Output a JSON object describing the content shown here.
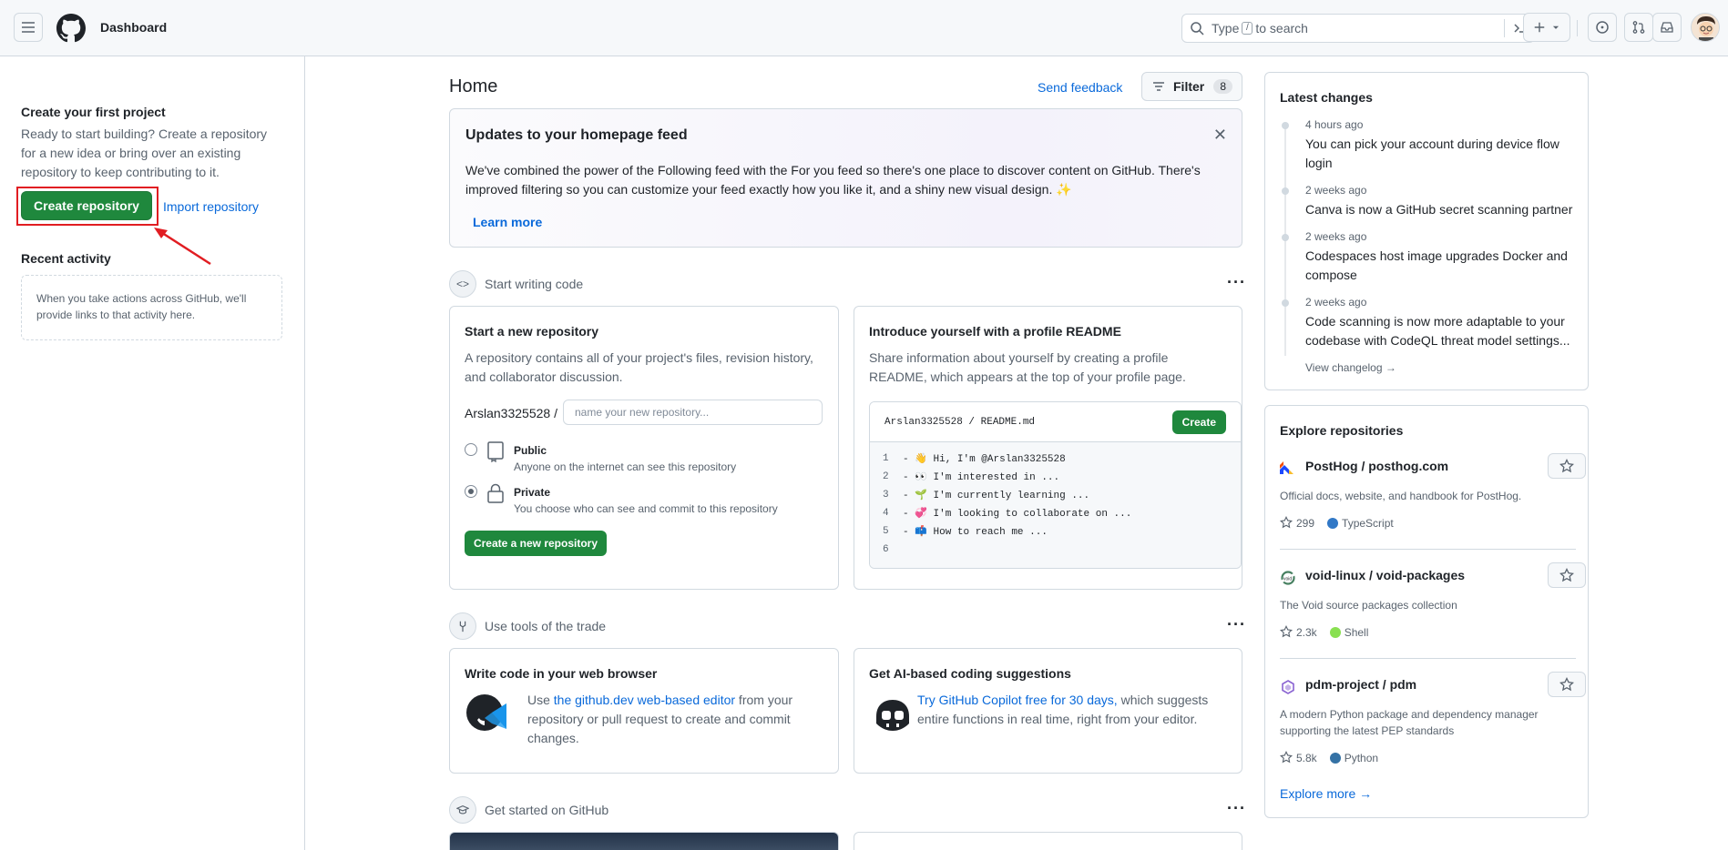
{
  "header": {
    "title": "Dashboard",
    "search": {
      "before_key": "Type",
      "key": "/",
      "after_key": "to search"
    }
  },
  "sidebar": {
    "create_title": "Create your first project",
    "create_desc": "Ready to start building? Create a repository for a new idea or bring over an existing repository to keep contributing to it.",
    "create_button": "Create repository",
    "import_link": "Import repository",
    "recent_title": "Recent activity",
    "recent_empty": "When you take actions across GitHub, we'll provide links to that activity here."
  },
  "main": {
    "title": "Home",
    "feedback": "Send feedback",
    "filter_label": "Filter",
    "filter_count": "8",
    "update": {
      "title": "Updates to your homepage feed",
      "text": "We've combined the power of the Following feed with the For you feed so there's one place to discover content on GitHub. There's improved filtering so you can customize your feed exactly how you like it, and a shiny new visual design. ✨",
      "learn_more": "Learn more"
    },
    "section1": "Start writing code",
    "new_repo": {
      "title": "Start a new repository",
      "desc": "A repository contains all of your project's files, revision history, and collaborator discussion.",
      "owner": "Arslan3325528 /",
      "placeholder": "name your new repository...",
      "public_label": "Public",
      "public_desc": "Anyone on the internet can see this repository",
      "private_label": "Private",
      "private_desc": "You choose who can see and commit to this repository",
      "button": "Create a new repository"
    },
    "readme": {
      "title": "Introduce yourself with a profile README",
      "desc": "Share information about yourself by creating a profile README, which appears at the top of your profile page.",
      "path": "Arslan3325528 / README.md",
      "create": "Create",
      "lines": [
        {
          "num": "1",
          "text": "- 👋 Hi, I'm @Arslan3325528"
        },
        {
          "num": "2",
          "text": "- 👀 I'm interested in ..."
        },
        {
          "num": "3",
          "text": "- 🌱 I'm currently learning ..."
        },
        {
          "num": "4",
          "text": "- 💞️ I'm looking to collaborate on ..."
        },
        {
          "num": "5",
          "text": "- 📫 How to reach me ..."
        },
        {
          "num": "6",
          "text": ""
        }
      ]
    },
    "section2": "Use tools of the trade",
    "browser": {
      "title": "Write code in your web browser",
      "pre": "Use ",
      "link": "the github.dev web-based editor",
      "post": " from your repository or pull request to create and commit changes."
    },
    "ai": {
      "title": "Get AI-based coding suggestions",
      "link": "Try GitHub Copilot free for 30 days,",
      "post": " which suggests entire functions in real time, right from your editor."
    },
    "section3": "Get started on GitHub"
  },
  "changes": {
    "title": "Latest changes",
    "items": [
      {
        "time": "4 hours ago",
        "text": "You can pick your account during device flow login"
      },
      {
        "time": "2 weeks ago",
        "text": "Canva is now a GitHub secret scanning partner"
      },
      {
        "time": "2 weeks ago",
        "text": "Codespaces host image upgrades Docker and compose"
      },
      {
        "time": "2 weeks ago",
        "text": "Code scanning is now more adaptable to your codebase with CodeQL threat model settings..."
      }
    ],
    "view_changelog": "View changelog →"
  },
  "explore": {
    "title": "Explore repositories",
    "repos": [
      {
        "owner": "PostHog",
        "name": "posthog.com",
        "desc": "Official docs, website, and handbook for PostHog.",
        "stars": "299",
        "lang": "TypeScript",
        "lang_color": "#3178c6"
      },
      {
        "owner": "void-linux",
        "name": "void-packages",
        "desc": "The Void source packages collection",
        "stars": "2.3k",
        "lang": "Shell",
        "lang_color": "#89e051"
      },
      {
        "owner": "pdm-project",
        "name": "pdm",
        "desc": "A modern Python package and dependency manager supporting the latest PEP standards",
        "stars": "5.8k",
        "lang": "Python",
        "lang_color": "#3572A5"
      }
    ],
    "more": "Explore more →"
  },
  "colors": {
    "accent": "#0969da",
    "primary_button": "#1f883d",
    "highlight_outline": "#e11d22"
  }
}
